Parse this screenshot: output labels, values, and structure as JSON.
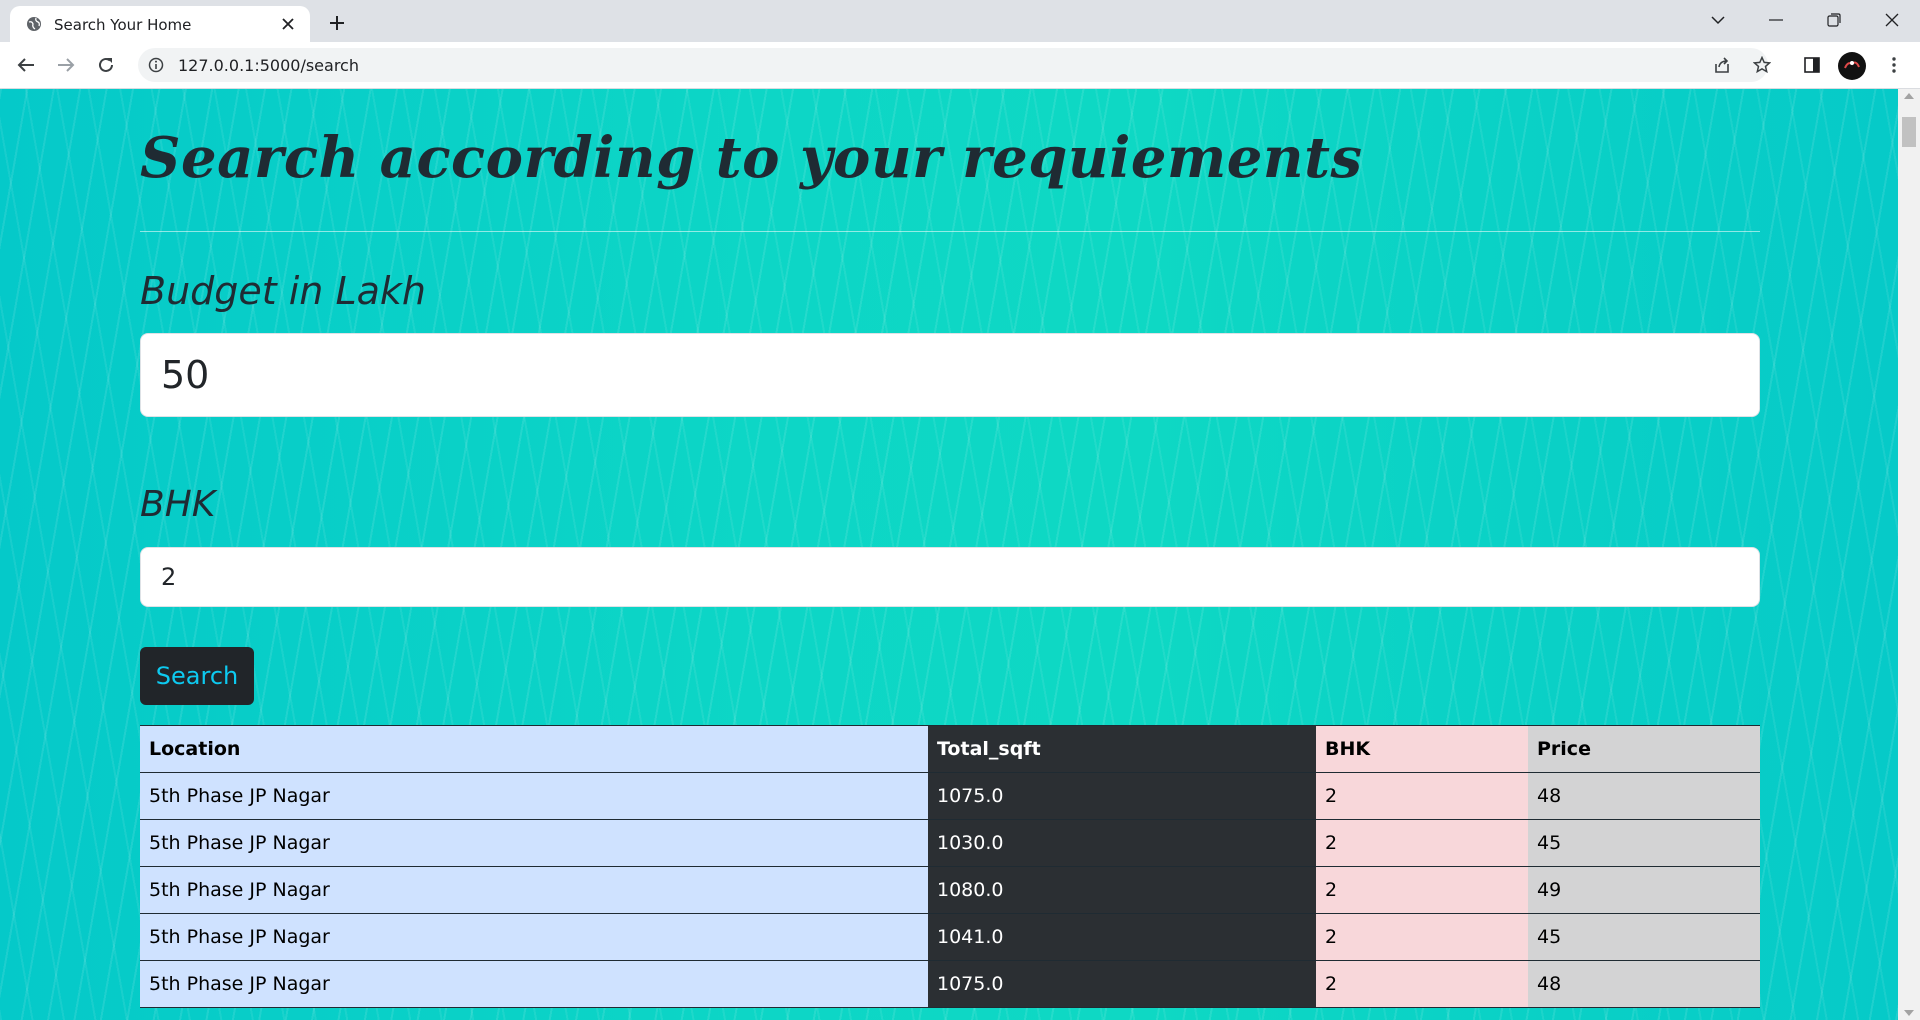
{
  "browser": {
    "tab_title": "Search Your Home",
    "url": "127.0.0.1:5000/search"
  },
  "page": {
    "title": "Search according to your requiements",
    "budget_label": "Budget in Lakh",
    "budget_value": "50",
    "bhk_label": "BHK",
    "bhk_value": "2",
    "search_button": "Search"
  },
  "table": {
    "headers": [
      "Location",
      "Total_sqft",
      "BHK",
      "Price"
    ],
    "rows": [
      [
        "5th Phase JP Nagar",
        "1075.0",
        "2",
        "48"
      ],
      [
        "5th Phase JP Nagar",
        "1030.0",
        "2",
        "45"
      ],
      [
        "5th Phase JP Nagar",
        "1080.0",
        "2",
        "49"
      ],
      [
        "5th Phase JP Nagar",
        "1041.0",
        "2",
        "45"
      ],
      [
        "5th Phase JP Nagar",
        "1075.0",
        "2",
        "48"
      ]
    ]
  },
  "colors": {
    "background": "#0dd6c6",
    "button_bg": "#212529",
    "button_text": "#0dcaf0",
    "col_location": "#cfe2ff",
    "col_sqft": "#2b2f33",
    "col_bhk": "#f8d7da",
    "col_price": "#d3d3d4"
  }
}
